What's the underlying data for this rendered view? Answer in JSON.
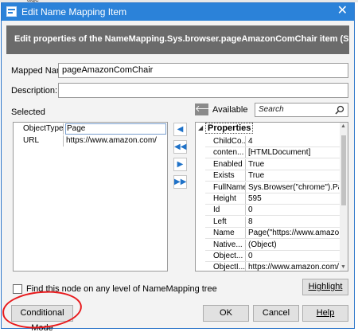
{
  "dialog": {
    "title": "Edit Name Mapping Item",
    "banner": "Edit properties of the NameMapping.Sys.browser.pageAmazonComChair item (Sys.Browser("
  },
  "form": {
    "mapped_name_prefix": "Mapped Name:",
    "mapped_name_value": "pageAmazonComChair",
    "description_prefix": "Description:",
    "description_value": ""
  },
  "selected": {
    "label": "Selected",
    "rows": [
      {
        "name": "ObjectType",
        "value": "Page"
      },
      {
        "name": "URL",
        "value": "https://www.amazon.com/"
      }
    ]
  },
  "available": {
    "label": "Available",
    "search_placeholder": "Search",
    "group": "Properties",
    "rows": [
      {
        "name": "ChildCo...",
        "value": "4"
      },
      {
        "name": "conten...",
        "value": "[HTMLDocument]"
      },
      {
        "name": "Enabled",
        "value": "True"
      },
      {
        "name": "Exists",
        "value": "True"
      },
      {
        "name": "FullName",
        "value": "Sys.Browser(\"chrome\").Pa..."
      },
      {
        "name": "Height",
        "value": "595"
      },
      {
        "name": "Id",
        "value": "0"
      },
      {
        "name": "Left",
        "value": "8"
      },
      {
        "name": "Name",
        "value": "Page(\"https://www.amazo..."
      },
      {
        "name": "Native...",
        "value": "(Object)"
      },
      {
        "name": "Object...",
        "value": "0"
      },
      {
        "name": "ObjectI...",
        "value": "https://www.amazon.com/"
      }
    ]
  },
  "find_node_label": "Find this node on any level of NameMapping tree",
  "buttons": {
    "highlight": "Highlight",
    "conditional_mode": "Conditional Mode",
    "ok": "OK",
    "cancel": "Cancel",
    "help": "Help"
  },
  "colors": {
    "titlebar": "#2b82d9",
    "banner": "#6b6b6b",
    "arrow": "#1f72c8",
    "annotation": "#e8191c"
  }
}
